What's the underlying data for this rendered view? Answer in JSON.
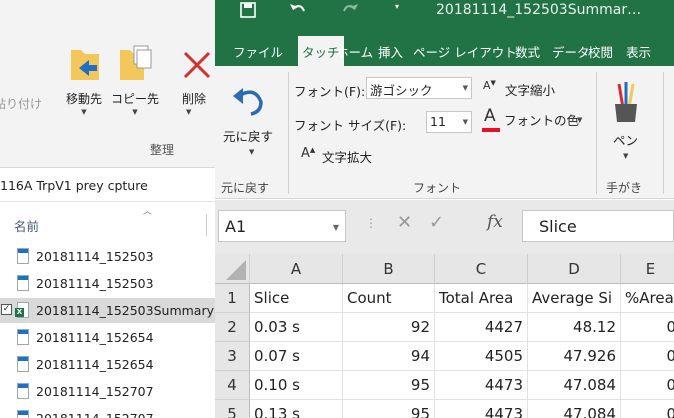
{
  "explorer": {
    "paste_label": "貼り付け",
    "move_label": "移動先",
    "copy_label": "コピー先",
    "delete_label": "削除",
    "group_label": "整理",
    "path": "116A TrpV1 prey cpture",
    "name_header": "名前",
    "files": [
      {
        "name": "20181114_152503",
        "type": "file"
      },
      {
        "name": "20181114_152503",
        "type": "file"
      },
      {
        "name": "20181114_152503Summary",
        "type": "excel"
      },
      {
        "name": "20181114_152654",
        "type": "file"
      },
      {
        "name": "20181114_152654",
        "type": "file"
      },
      {
        "name": "20181114_152707",
        "type": "file"
      },
      {
        "name": "20181114_152707",
        "type": "file"
      }
    ]
  },
  "excel": {
    "title": "20181114_152503Summar…",
    "tabs": [
      "ファイル",
      "タッチ",
      "ホーム",
      "挿入",
      "ページ レイアウト",
      "数式",
      "データ",
      "校閲",
      "表示"
    ],
    "active_tab": "タッチ",
    "ribbon": {
      "undo_label": "元に戻す",
      "undo_group": "元に戻す",
      "font_label": "フォント(F):",
      "font_value": "游ゴシック",
      "size_label": "フォント サイズ(F):",
      "size_value": "11",
      "grow_label": "文字拡大",
      "shrink_label": "文字縮小",
      "font_color_label": "フォントの色",
      "font_group": "フォント",
      "pen_label": "ペン",
      "handwriting_group": "手がき",
      "font_color": "#e81123"
    },
    "name_box": "A1",
    "formula": "Slice",
    "fx_symbol": "fx",
    "columns": [
      "A",
      "B",
      "C",
      "D",
      "E"
    ],
    "rows": [
      {
        "num": "1",
        "cells": [
          "Slice",
          "Count",
          "Total Area",
          "Average Si",
          "%Area"
        ]
      },
      {
        "num": "2",
        "cells": [
          "0.03 s",
          "92",
          "4427",
          "48.12",
          "0"
        ]
      },
      {
        "num": "3",
        "cells": [
          "0.07 s",
          "94",
          "4505",
          "47.926",
          "0"
        ]
      },
      {
        "num": "4",
        "cells": [
          "0.10 s",
          "95",
          "4473",
          "47.084",
          "0"
        ]
      },
      {
        "num": "5",
        "cells": [
          "0.13 s",
          "95",
          "4473",
          "47.084",
          "0"
        ]
      }
    ],
    "accent": "#217346"
  }
}
